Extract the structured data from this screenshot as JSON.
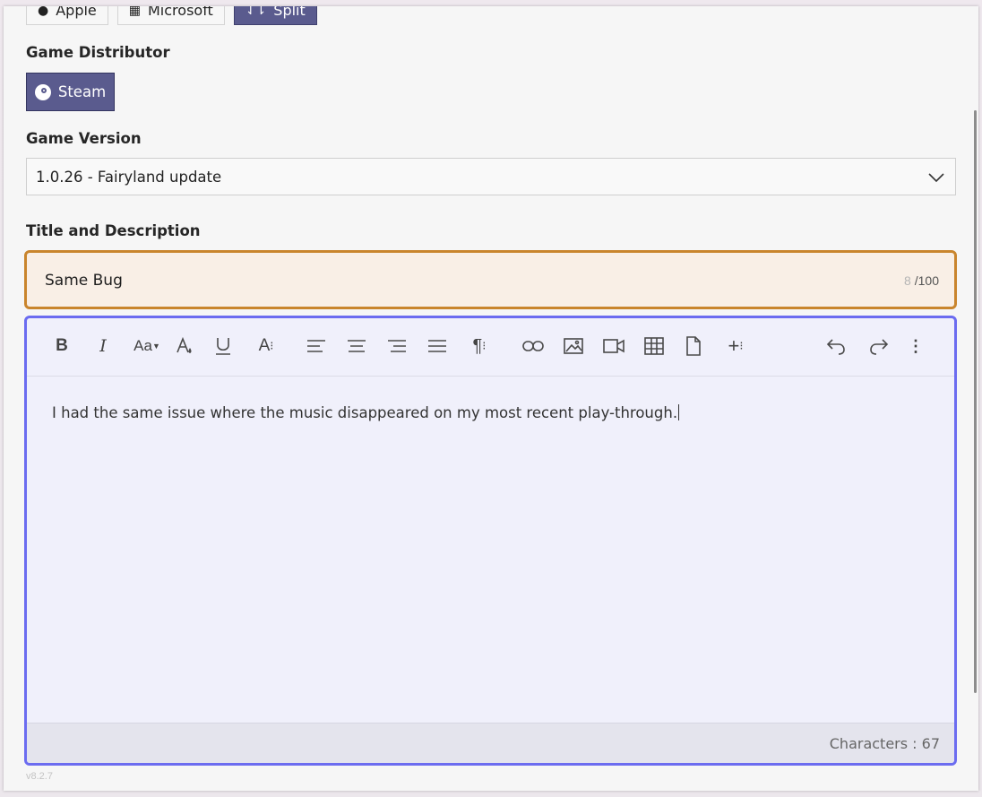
{
  "platforms": [
    {
      "label": "Apple",
      "icon": "apple-icon",
      "selected": false
    },
    {
      "label": "Microsoft",
      "icon": "windows-icon",
      "selected": false
    },
    {
      "label": "Split",
      "icon": "split-icon",
      "selected": true
    }
  ],
  "distributor": {
    "label": "Game Distributor",
    "button": "Steam",
    "icon": "steam-icon"
  },
  "version_select": {
    "label": "Game Version",
    "value": "1.0.26 - Fairyland update"
  },
  "title_section": {
    "label": "Title and Description",
    "title_value": "Same Bug",
    "count": "8",
    "max": "/100"
  },
  "editor": {
    "toolbar": [
      "bold",
      "italic",
      "font-size",
      "font-color",
      "underline",
      "text-style",
      "align-left",
      "align-center",
      "align-right",
      "justify",
      "paragraph",
      "link",
      "image",
      "video",
      "table",
      "file",
      "insert-more",
      "undo",
      "redo",
      "more-options"
    ],
    "content": "I had the same issue where the music disappeared on my most recent play-through.",
    "char_count_label": "Characters : 67"
  },
  "app_version": "v8.2.7",
  "colors": {
    "selected_bg": "#5a5b8e",
    "title_border": "#c9852d",
    "editor_border": "#6b6cf0"
  }
}
